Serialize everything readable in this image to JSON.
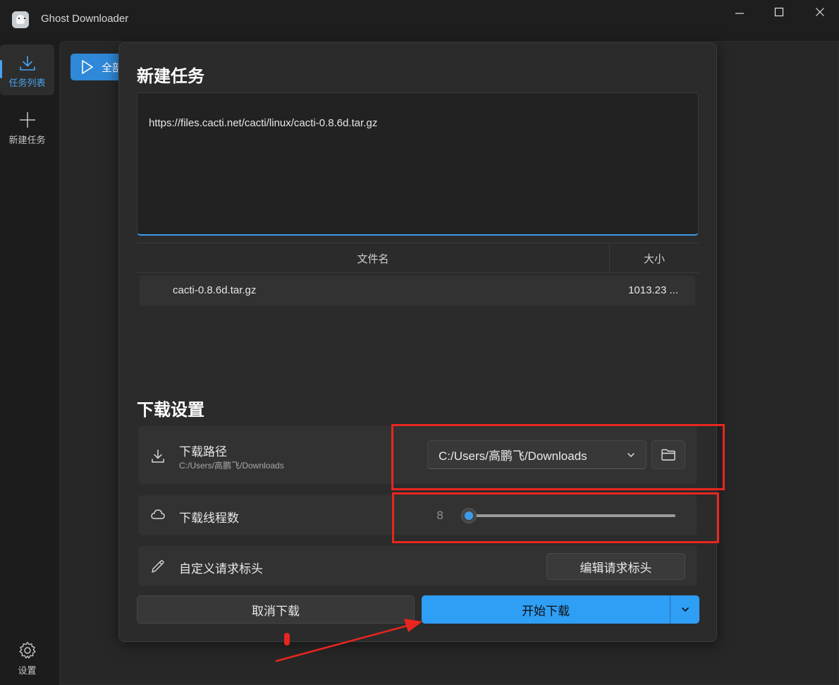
{
  "window": {
    "title": "Ghost Downloader",
    "controls": [
      "minimize",
      "maximize",
      "close"
    ]
  },
  "sidebar": {
    "items": [
      {
        "label": "任务列表",
        "icon": "download-icon",
        "active": true
      },
      {
        "label": "新建任务",
        "icon": "plus-icon",
        "active": false
      }
    ],
    "settings": {
      "label": "设置",
      "icon": "gear-icon"
    }
  },
  "background": {
    "button_label": "全部"
  },
  "dialog": {
    "title": "新建任务",
    "url_text": "https://files.cacti.net/cacti/linux/cacti-0.8.6d.tar.gz",
    "table": {
      "columns": [
        "文件名",
        "大小"
      ],
      "rows": [
        {
          "name": "cacti-0.8.6d.tar.gz",
          "size": "1013.23 ..."
        }
      ]
    },
    "settings_title": "下载设置",
    "path_card": {
      "label": "下载路径",
      "sub": "C:/Users/高鹏飞/Downloads",
      "selected": "C:/Users/高鹏飞/Downloads"
    },
    "threads_card": {
      "label": "下载线程数",
      "value": "8",
      "slider_fraction": 0.0
    },
    "headers_card": {
      "label": "自定义请求标头",
      "button": "编辑请求标头"
    },
    "cancel_label": "取消下载",
    "start_label": "开始下载"
  },
  "colors": {
    "accent": "#2f9ef5",
    "annotation": "#e8261f",
    "dialog_bg": "#2b2b2b"
  }
}
